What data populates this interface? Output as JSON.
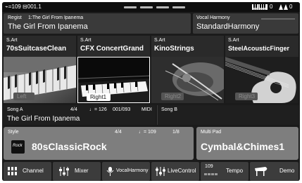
{
  "status": {
    "left_text": "⌁=109  ⊟001.1",
    "icons": [
      "keyboard-icon",
      "metronome-icon"
    ],
    "counts": [
      "0",
      "0"
    ]
  },
  "registration": {
    "label": "Regist",
    "bank_info": "1:The Girl From Ipanema",
    "name": "The Girl From Ipanema"
  },
  "vocal_harmony": {
    "label": "Vocal Harmony",
    "value": "StandardHarmony"
  },
  "voices": [
    {
      "category": "S.Art",
      "name": "70sSuitcaseClean",
      "part": "Left",
      "active": false,
      "icon": "electric-piano-photo"
    },
    {
      "category": "S.Art",
      "name": "CFX ConcertGrand",
      "part": "Right1",
      "active": true,
      "icon": "grand-piano-photo"
    },
    {
      "category": "S.Art",
      "name": "KinoStrings",
      "part": "Right2",
      "active": false,
      "icon": "violin-photo"
    },
    {
      "category": "S.Art",
      "name": "SteelAcousticFinger",
      "part": "Right3",
      "active": false,
      "icon": "acoustic-guitar-photo"
    }
  ],
  "song_a": {
    "label": "Song A",
    "time_sig": "4/4",
    "tempo": "♩= 126",
    "position": "001/093",
    "type": "MIDI",
    "name": "The Girl From Ipanema"
  },
  "song_b": {
    "label": "Song B"
  },
  "style": {
    "label": "Style",
    "time_sig": "4/4",
    "tempo": "♩= 109",
    "measure": "1/8",
    "icon_text": "Rock",
    "name": "80sClassicRock"
  },
  "multipad": {
    "label": "Multi Pad",
    "name": "Cymbal&Chimes1"
  },
  "bottom_buttons": [
    {
      "label": "Channel",
      "icon": "channel-grid-icon"
    },
    {
      "label": "Mixer",
      "icon": "mixer-faders-icon"
    },
    {
      "label": "VocalHarmony",
      "icon": "vocal-harmony-icon"
    },
    {
      "label": "LiveControl",
      "icon": "live-control-icon"
    },
    {
      "label": "Tempo",
      "icon": "tempo-icon",
      "value": "109"
    },
    {
      "label": "Demo",
      "icon": "demo-piano-icon"
    }
  ]
}
